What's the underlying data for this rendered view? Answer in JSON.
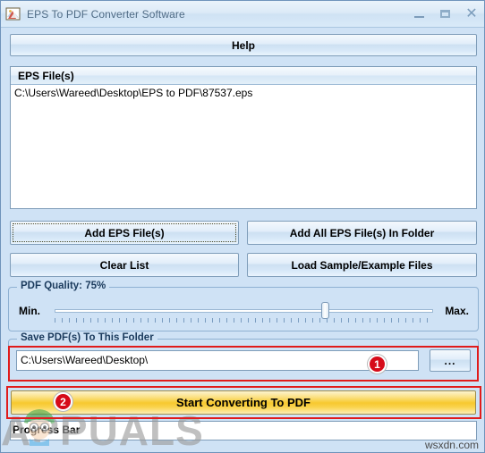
{
  "window": {
    "title": "EPS To PDF Converter Software",
    "icon": "app-image-icon",
    "controls": {
      "minimize": "minimize-icon",
      "maximize": "maximize-icon",
      "close": "✕"
    }
  },
  "toolbar": {
    "help_label": "Help"
  },
  "file_list": {
    "column_header": "EPS File(s)",
    "rows": [
      "C:\\Users\\Wareed\\Desktop\\EPS to PDF\\87537.eps"
    ]
  },
  "actions": {
    "add_eps": "Add EPS File(s)",
    "add_all_in_folder": "Add All EPS File(s) In Folder",
    "clear_list": "Clear List",
    "load_samples": "Load Sample/Example Files"
  },
  "quality": {
    "legend": "PDF Quality: 75%",
    "min_label": "Min.",
    "max_label": "Max.",
    "value": 75
  },
  "folder": {
    "legend": "Save PDF(s) To This Folder",
    "path": "C:\\Users\\Wareed\\Desktop\\",
    "placeholder": "C:\\Users\\Wareed\\Desktop\\",
    "browse_label": "..."
  },
  "convert": {
    "start_label": "Start Converting To PDF"
  },
  "progress": {
    "label": "Progress Bar",
    "percent": 0
  },
  "annotations": {
    "badge_one": "1",
    "badge_two": "2",
    "highlight_color": "#e01b1b",
    "badge_color": "#d60b19"
  },
  "watermarks": {
    "appuals": "APPUALS",
    "site": "wsxdn.com"
  },
  "colors": {
    "window_bg": "#cfe2f5",
    "accent_button": "#f7c92f",
    "border": "#7f9db9",
    "title_text": "#4f6b85"
  }
}
